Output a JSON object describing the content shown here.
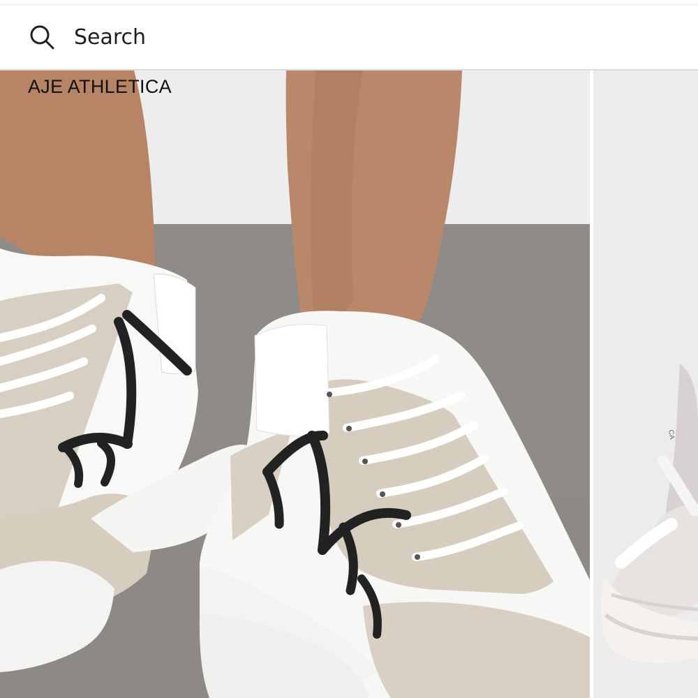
{
  "search": {
    "placeholder": "Search",
    "value": ""
  },
  "products": [
    {
      "brand": "AJE ATHLETICA",
      "image": "white-beige-chunky-sneakers-worn"
    },
    {
      "brand": "",
      "image": "pink-white-chunky-sneaker-partial",
      "visible_logo_text": "CA"
    }
  ],
  "colors": {
    "search_border": "#dcdcdc",
    "text": "#111111",
    "floor": "#8f8c89",
    "wall": "#ececec"
  },
  "icons": {
    "search": "search-icon"
  }
}
